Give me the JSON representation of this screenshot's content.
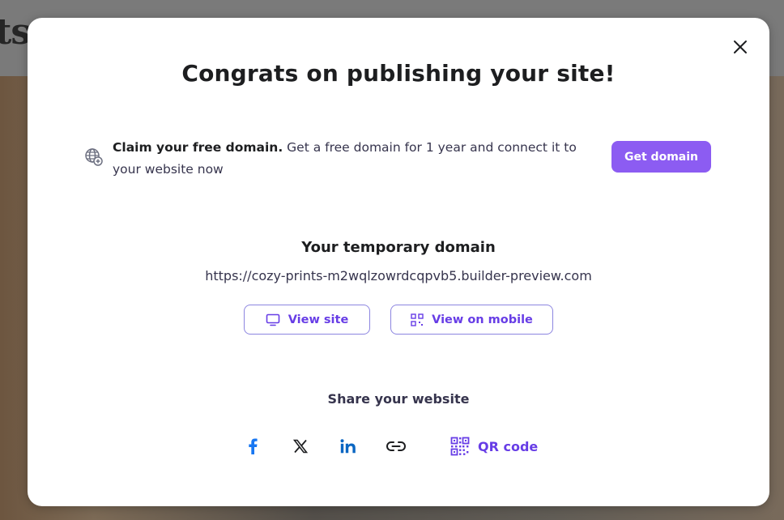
{
  "background": {
    "logo_text": "ts"
  },
  "modal": {
    "title": "Congrats on publishing your site!",
    "close_icon": "close-icon",
    "promo": {
      "icon": "globe-plus-icon",
      "bold": "Claim your free domain.",
      "text": " Get a free domain for 1 year and connect it to your website now",
      "button": "Get domain"
    },
    "temporary": {
      "title": "Your temporary domain",
      "url": "https://cozy-prints-m2wqlzowrdcqpvb5.builder-preview.com",
      "view_site": "View site",
      "view_mobile": "View on mobile"
    },
    "share": {
      "title": "Share your website",
      "icons": [
        "facebook-icon",
        "x-icon",
        "linkedin-icon",
        "link-icon"
      ],
      "qr_label": "QR code"
    }
  },
  "colors": {
    "accent": "#673de6",
    "button_fill": "#8c5cf2",
    "facebook": "#1877f2",
    "linkedin": "#0a66c2"
  }
}
